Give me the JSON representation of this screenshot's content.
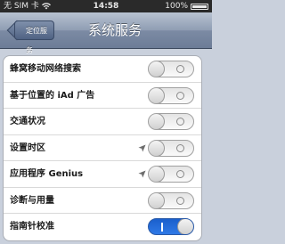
{
  "status_bar": {
    "carrier": "无 SIM 卡",
    "time": "14:58",
    "battery": "100%"
  },
  "nav": {
    "back_label": "定位服务",
    "title": "系统服务"
  },
  "rows": [
    {
      "label": "蜂窝移动网络搜索",
      "on": false,
      "location_arrow": false
    },
    {
      "label": "基于位置的 iAd 广告",
      "on": false,
      "location_arrow": false
    },
    {
      "label": "交通状况",
      "on": false,
      "location_arrow": false
    },
    {
      "label": "设置时区",
      "on": false,
      "location_arrow": true
    },
    {
      "label": "应用程序 Genius",
      "on": false,
      "location_arrow": true
    },
    {
      "label": "诊断与用量",
      "on": false,
      "location_arrow": false
    },
    {
      "label": "指南针校准",
      "on": true,
      "location_arrow": false
    }
  ],
  "colors": {
    "toggle_on": "#2f79e6",
    "nav_bar": "#7c8ba4",
    "background": "#c9d0dc"
  },
  "icons": {
    "wifi": "wifi-icon",
    "battery": "battery-icon",
    "location": "location-arrow-icon"
  }
}
